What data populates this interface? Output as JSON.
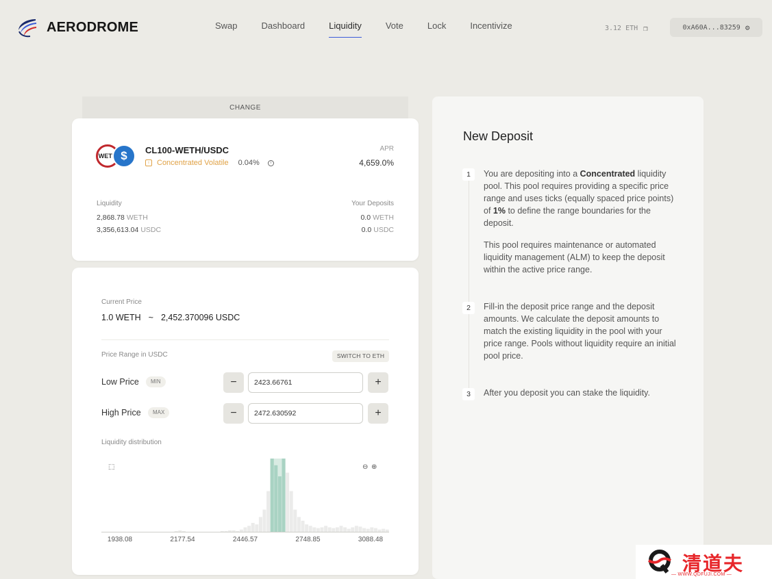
{
  "header": {
    "brand": "AERODROME",
    "nav": [
      "Swap",
      "Dashboard",
      "Liquidity",
      "Vote",
      "Lock",
      "Incentivize"
    ],
    "active_nav": "Liquidity",
    "balance": "3.12 ETH",
    "wallet": "0xA60A...83259"
  },
  "change_tab": "CHANGE",
  "pool": {
    "weth_badge": "WETH",
    "usdc_badge": "$",
    "name": "CL100-WETH/USDC",
    "type_icon": "↑",
    "type": "Concentrated Volatile",
    "fee": "0.04%",
    "apr_label": "APR",
    "apr": "4,659.0%",
    "liquidity_label": "Liquidity",
    "liquidity": [
      {
        "amount": "2,868.78",
        "unit": "WETH"
      },
      {
        "amount": "3,356,613.04",
        "unit": "USDC"
      }
    ],
    "deposits_label": "Your Deposits",
    "deposits": [
      {
        "amount": "0.0",
        "unit": "WETH"
      },
      {
        "amount": "0.0",
        "unit": "USDC"
      }
    ]
  },
  "range": {
    "current_price_label": "Current Price",
    "current_price_base": "1.0 WETH",
    "tilde": "~",
    "current_price_quote": "2,452.370096 USDC",
    "price_range_label": "Price Range in USDC",
    "switch_label": "SWITCH TO ETH",
    "low_label": "Low Price",
    "low_pill": "MIN",
    "low_value": "2423.66761",
    "high_label": "High Price",
    "high_pill": "MAX",
    "high_value": "2472.630592",
    "minus": "−",
    "plus": "+",
    "distribution_label": "Liquidity distribution"
  },
  "chart_data": {
    "type": "bar",
    "x_ticks": [
      "1938.08",
      "2177.54",
      "2446.57",
      "2748.85",
      "3088.48"
    ],
    "values": [
      0,
      0,
      0,
      0,
      0,
      0,
      0,
      0,
      0,
      0,
      0,
      0,
      0,
      0,
      0,
      0,
      0,
      0,
      0,
      1,
      2,
      1,
      0,
      0,
      0,
      0,
      0,
      0,
      0,
      0,
      0,
      1,
      1,
      2,
      2,
      1,
      3,
      6,
      8,
      12,
      10,
      20,
      30,
      55,
      100,
      90,
      75,
      100,
      80,
      55,
      30,
      20,
      15,
      10,
      8,
      6,
      5,
      6,
      8,
      6,
      5,
      6,
      8,
      6,
      4,
      6,
      8,
      7,
      5,
      4,
      6,
      5,
      3,
      4,
      3
    ],
    "highlight_range": [
      44,
      48
    ],
    "xlim": [
      1938.08,
      3088.48
    ]
  },
  "deposit": {
    "title": "New Deposit",
    "steps": [
      {
        "num": "1",
        "pre": "You are depositing into a ",
        "bold": "Concentrated",
        "mid": " liquidity pool. This pool requires providing a specific price range and uses ticks (equally spaced price points) of ",
        "bold2": "1%",
        "post": " to define the range boundaries for the deposit.",
        "extra": "This pool requires maintenance or automated liquidity management (ALM) to keep the deposit within the active price range."
      },
      {
        "num": "2",
        "text": "Fill-in the deposit price range and the deposit amounts. We calculate the deposit amounts to match the existing liquidity in the pool with your price range. Pools without liquidity require an initial pool price."
      },
      {
        "num": "3",
        "text": "After you deposit you can stake the liquidity."
      }
    ]
  },
  "watermark": {
    "text": "清道夫",
    "url": "— WWW.QDFUJI.COM —"
  }
}
